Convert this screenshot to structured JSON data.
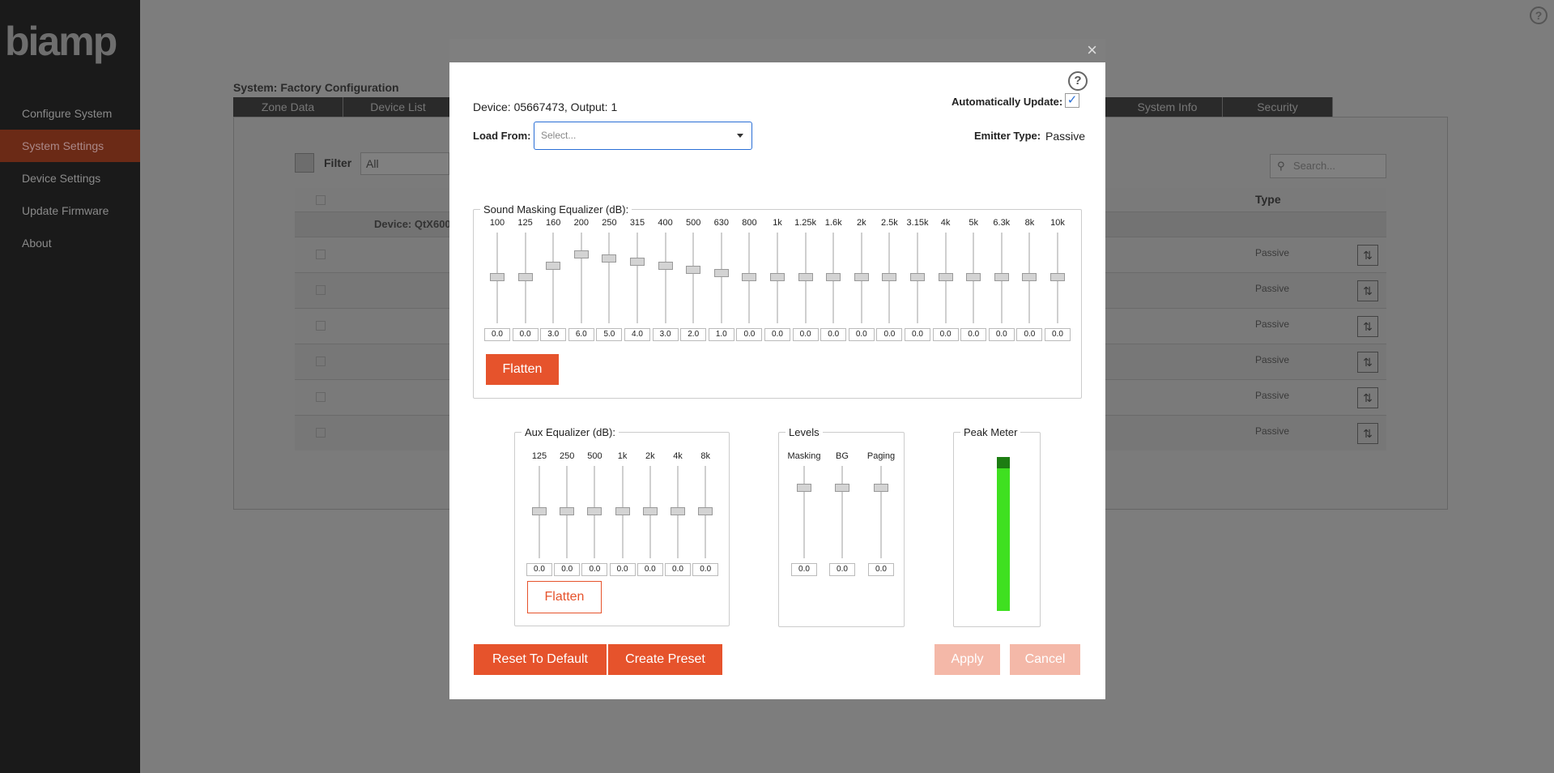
{
  "app": {
    "logo": "biamp",
    "nav": [
      "Configure System",
      "System Settings",
      "Device Settings",
      "Update Firmware",
      "About"
    ],
    "active_nav": 1,
    "help": "?",
    "system_title": "System: Factory Configuration",
    "tabs": [
      "Zone Data",
      "Device List",
      "System Info",
      "Security"
    ],
    "filter_label": "Filter",
    "filter_value": "All",
    "search_placeholder": "Search...",
    "column_type": "Type",
    "group_label": "Device: QtX600",
    "rows": [
      "Passive",
      "Passive",
      "Passive",
      "Passive",
      "Passive",
      "Passive"
    ]
  },
  "modal": {
    "close": "×",
    "help": "?",
    "device_line": "Device: 05667473, Output: 1",
    "auto_update_label": "Automatically Update:",
    "auto_update_checked": "✓",
    "load_from_label": "Load From:",
    "load_from_placeholder": "Select...",
    "emitter_label": "Emitter Type:",
    "emitter_value": "Passive",
    "sound_masking": {
      "legend": "Sound Masking Equalizer (dB):",
      "bands": [
        "100",
        "125",
        "160",
        "200",
        "250",
        "315",
        "400",
        "500",
        "630",
        "800",
        "1k",
        "1.25k",
        "1.6k",
        "2k",
        "2.5k",
        "3.15k",
        "4k",
        "5k",
        "6.3k",
        "8k",
        "10k"
      ],
      "values": [
        "0.0",
        "0.0",
        "3.0",
        "6.0",
        "5.0",
        "4.0",
        "3.0",
        "2.0",
        "1.0",
        "0.0",
        "0.0",
        "0.0",
        "0.0",
        "0.0",
        "0.0",
        "0.0",
        "0.0",
        "0.0",
        "0.0",
        "0.0",
        "0.0"
      ],
      "flatten_label": "Flatten"
    },
    "aux": {
      "legend": "Aux Equalizer (dB):",
      "bands": [
        "125",
        "250",
        "500",
        "1k",
        "2k",
        "4k",
        "8k"
      ],
      "values": [
        "0.0",
        "0.0",
        "0.0",
        "0.0",
        "0.0",
        "0.0",
        "0.0"
      ],
      "flatten_label": "Flatten"
    },
    "levels": {
      "legend": "Levels",
      "channels": [
        "Masking",
        "BG",
        "Paging"
      ],
      "values": [
        "0.0",
        "0.0",
        "0.0"
      ]
    },
    "peak": {
      "legend": "Peak Meter",
      "level_fraction": 1.0
    },
    "buttons": {
      "reset": "Reset To Default",
      "create_preset": "Create Preset",
      "apply": "Apply",
      "cancel": "Cancel"
    },
    "colors": {
      "accent": "#e6532c",
      "accent_muted": "#f4b8a8",
      "meter": "#3fe020"
    }
  }
}
